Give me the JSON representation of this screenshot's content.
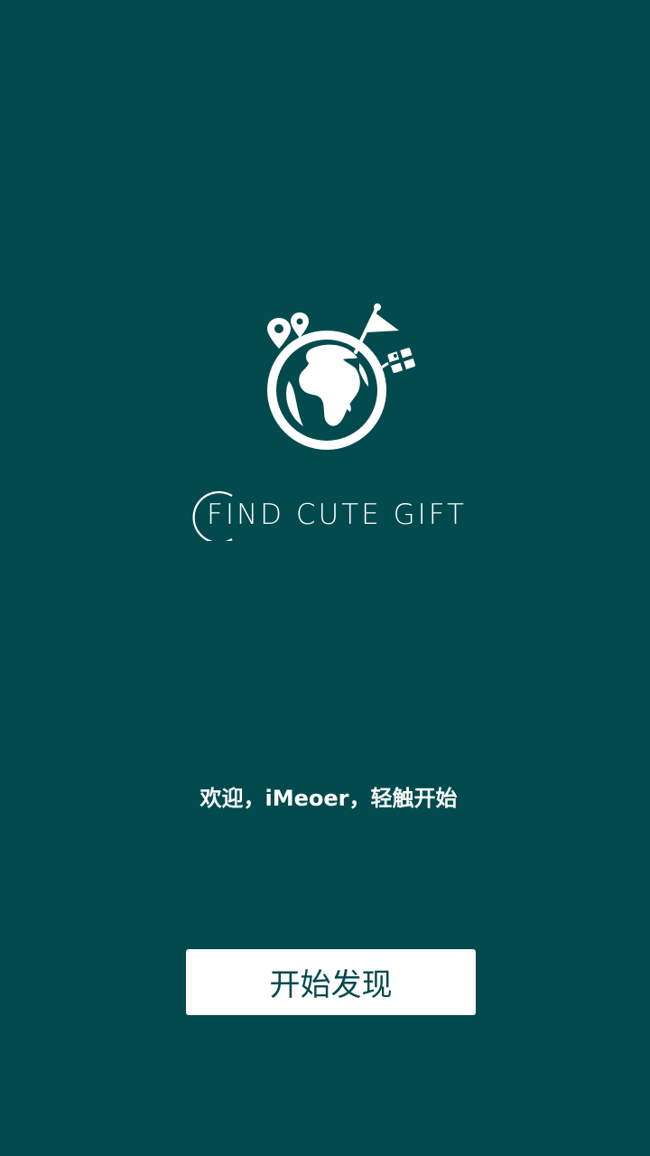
{
  "brand": {
    "name": "FIND CUTE GIFT"
  },
  "welcome": {
    "text": "欢迎，iMeoer，轻触开始"
  },
  "start_button": {
    "label": "开始发现"
  },
  "colors": {
    "background": "#024a4e",
    "foreground": "#ffffff"
  },
  "icons": {
    "logo": "globe-with-pins-flag-gift-icon"
  }
}
